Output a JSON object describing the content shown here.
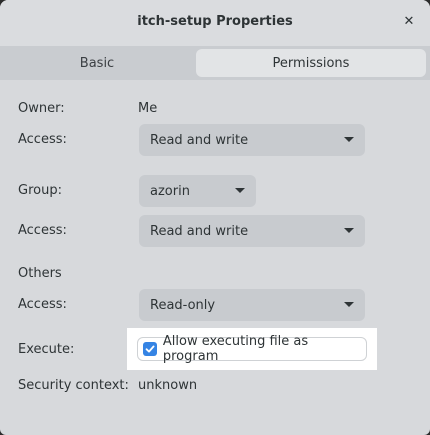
{
  "window": {
    "title": "itch-setup Properties"
  },
  "tabs": [
    {
      "label": "Basic",
      "active": false
    },
    {
      "label": "Permissions",
      "active": true
    }
  ],
  "owner": {
    "label": "Owner:",
    "value": "Me",
    "access_label": "Access:",
    "access_value": "Read and write"
  },
  "group": {
    "label": "Group:",
    "value": "azorin",
    "access_label": "Access:",
    "access_value": "Read and write"
  },
  "others": {
    "label": "Others",
    "access_label": "Access:",
    "access_value": "Read-only"
  },
  "execute": {
    "label": "Execute:",
    "checkbox_label": "Allow executing file as program",
    "checked": true
  },
  "security": {
    "label": "Security context:",
    "value": "unknown"
  },
  "colors": {
    "accent": "#3584e4",
    "window_bg": "#d7d9dc"
  },
  "icons": {
    "close": "close-icon",
    "dropdown": "chevron-down-icon",
    "check": "checkmark-icon"
  }
}
